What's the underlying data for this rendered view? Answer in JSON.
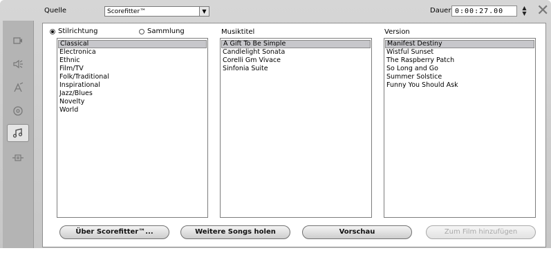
{
  "topbar": {
    "source_label": "Quelle",
    "source_value": "Scorefitter™",
    "duration_label": "Dauer:",
    "duration_value": "0:00:27.00"
  },
  "sidebar": {
    "icons": [
      "video-icon",
      "audio-icon",
      "title-icon",
      "disc-icon",
      "music-icon",
      "settings-icon"
    ],
    "active": "music-icon"
  },
  "mode": {
    "style_label": "Stilrichtung",
    "collection_label": "Sammlung",
    "selected": "Stilrichtung"
  },
  "styles": {
    "items": [
      "Classical",
      "Electronica",
      "Ethnic",
      "Film/TV",
      "Folk/Traditional",
      "Inspirational",
      "Jazz/Blues",
      "Novelty",
      "World"
    ],
    "selected": "Classical"
  },
  "songs": {
    "header": "Musiktitel",
    "items": [
      "A Gift To Be Simple",
      "Candlelight Sonata",
      "Corelli Gm Vivace",
      "Sinfonia Suite"
    ],
    "selected": "A Gift To Be Simple"
  },
  "versions": {
    "header": "Version",
    "items": [
      "Manifest Destiny",
      "Wistful Sunset",
      "The Raspberry Patch",
      "So Long and Go",
      "Summer Solstice",
      "Funny You Should Ask"
    ],
    "selected": "Manifest Destiny"
  },
  "buttons": {
    "about": "Über Scorefitter™...",
    "more_songs": "Weitere Songs holen",
    "preview": "Vorschau",
    "add_to_movie": "Zum Film hinzufügen"
  },
  "colors": {
    "selection": "#c7c7cb",
    "frame": "#cfcfcf"
  }
}
